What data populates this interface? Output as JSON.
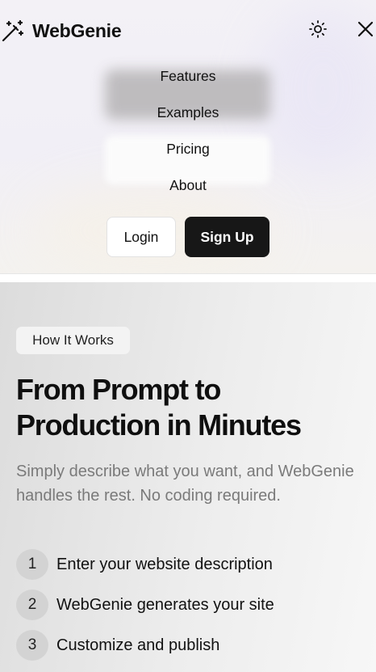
{
  "header": {
    "brand": "WebGenie",
    "theme_icon": "sun-icon",
    "close_icon": "close-icon",
    "logo_icon": "magic-wand-icon"
  },
  "nav": {
    "items": [
      {
        "label": "Features"
      },
      {
        "label": "Examples"
      },
      {
        "label": "Pricing"
      },
      {
        "label": "About"
      }
    ]
  },
  "auth": {
    "login_label": "Login",
    "signup_label": "Sign Up"
  },
  "how_it_works": {
    "badge": "How It Works",
    "headline_line1": "From Prompt to",
    "headline_line2": "Production in Minutes",
    "lead": "Simply describe what you want, and WebGenie handles the rest. No coding required.",
    "steps": [
      {
        "number": "1",
        "label": "Enter your website description"
      },
      {
        "number": "2",
        "label": "WebGenie generates your site"
      },
      {
        "number": "3",
        "label": "Customize and publish"
      }
    ]
  },
  "colors": {
    "primary_button": "#171717",
    "muted_text": "#7a7a7a",
    "step_circle": "#d3d3d3"
  }
}
